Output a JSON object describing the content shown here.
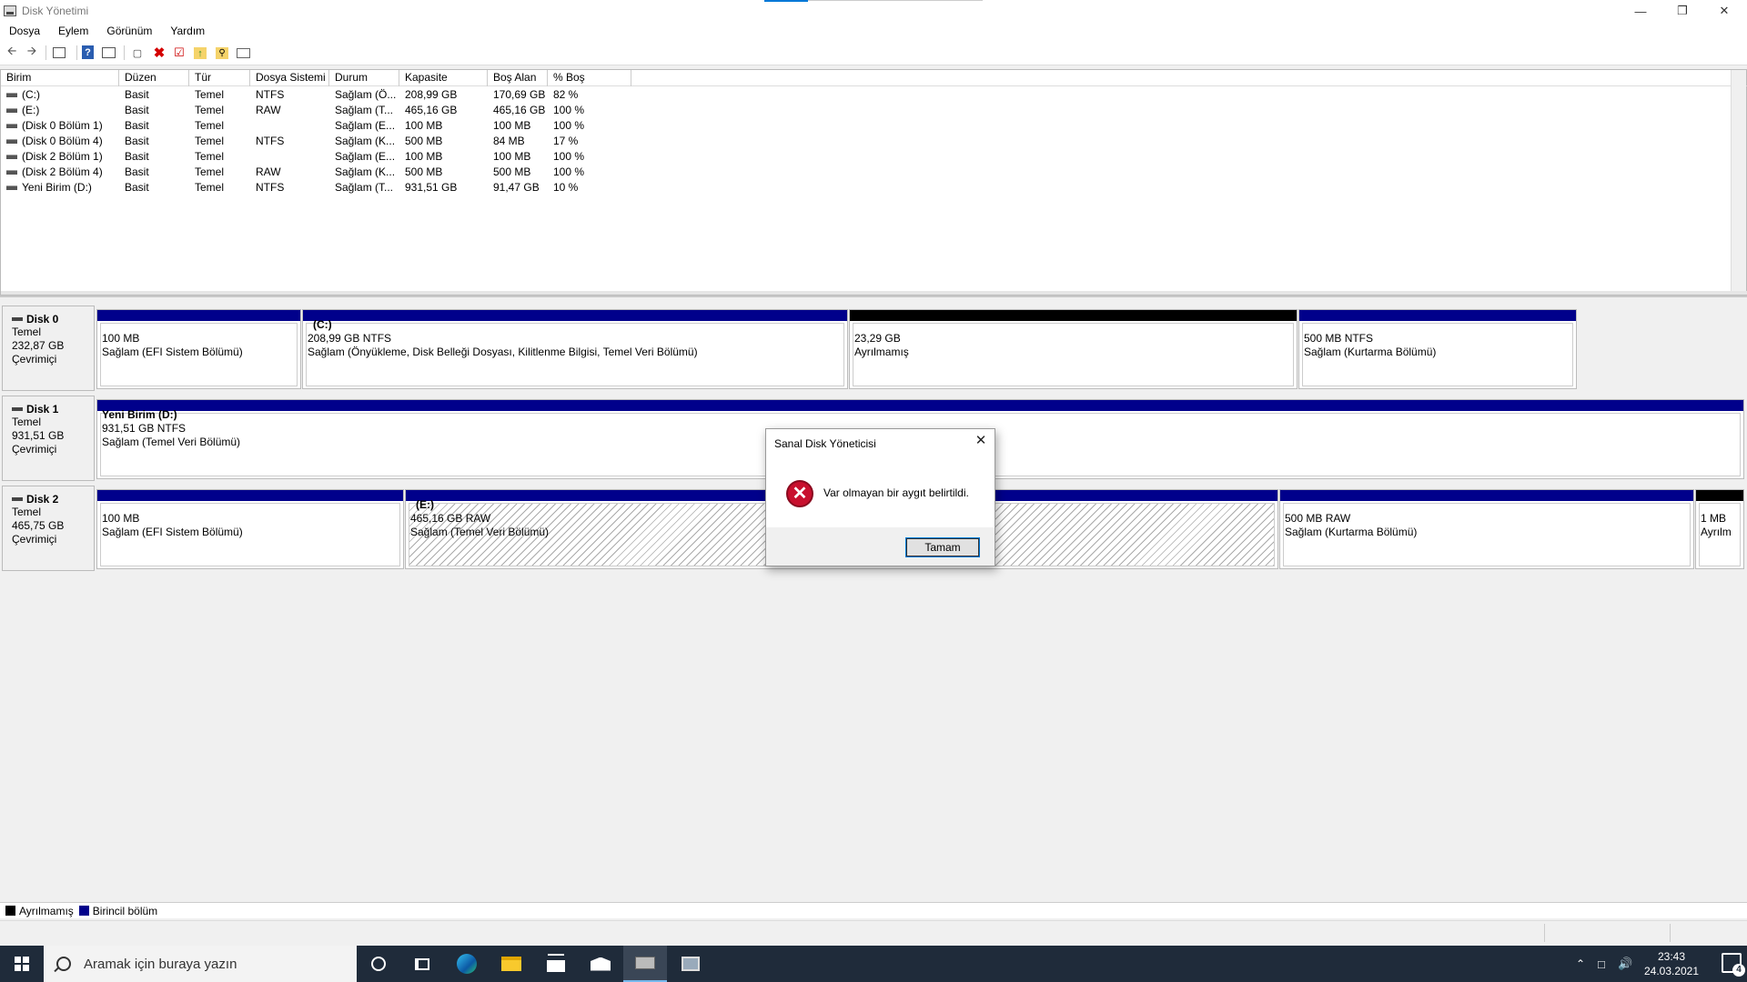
{
  "window": {
    "title": "Disk Yönetimi"
  },
  "menu": [
    "Dosya",
    "Eylem",
    "Görünüm",
    "Yardım"
  ],
  "toolbar": {
    "icons": [
      "back-icon",
      "forward-icon",
      "console-tree-icon",
      "help-icon",
      "properties-icon",
      "connect-icon",
      "delete-icon",
      "check-icon",
      "up-folder-icon",
      "search-folder-icon",
      "view-icon"
    ]
  },
  "volumes": {
    "headers": [
      "Birim",
      "Düzen",
      "Tür",
      "Dosya Sistemi",
      "Durum",
      "Kapasite",
      "Boş Alan",
      "% Boş"
    ],
    "rows": [
      [
        "(C:)",
        "Basit",
        "Temel",
        "NTFS",
        "Sağlam (Ö...",
        "208,99 GB",
        "170,69 GB",
        "82 %"
      ],
      [
        "(E:)",
        "Basit",
        "Temel",
        "RAW",
        "Sağlam (T...",
        "465,16 GB",
        "465,16 GB",
        "100 %"
      ],
      [
        "(Disk 0 Bölüm 1)",
        "Basit",
        "Temel",
        "",
        "Sağlam (E...",
        "100 MB",
        "100 MB",
        "100 %"
      ],
      [
        "(Disk 0 Bölüm 4)",
        "Basit",
        "Temel",
        "NTFS",
        "Sağlam (K...",
        "500 MB",
        "84 MB",
        "17 %"
      ],
      [
        "(Disk 2 Bölüm 1)",
        "Basit",
        "Temel",
        "",
        "Sağlam (E...",
        "100 MB",
        "100 MB",
        "100 %"
      ],
      [
        "(Disk 2 Bölüm 4)",
        "Basit",
        "Temel",
        "RAW",
        "Sağlam (K...",
        "500 MB",
        "500 MB",
        "100 %"
      ],
      [
        "Yeni Birim (D:)",
        "Basit",
        "Temel",
        "NTFS",
        "Sağlam (T...",
        "931,51 GB",
        "91,47 GB",
        "10 %"
      ]
    ]
  },
  "disks": [
    {
      "name": "Disk 0",
      "type": "Temel",
      "size": "232,87 GB",
      "status": "Çevrimiçi",
      "partitions": [
        {
          "title": "",
          "size": "100 MB",
          "status": "Sağlam (EFI Sistem Bölümü)",
          "kind": "primary"
        },
        {
          "title": "(C:)",
          "size": "208,99 GB NTFS",
          "status": "Sağlam (Önyükleme, Disk Belleği Dosyası, Kilitlenme Bilgisi, Temel Veri Bölümü)",
          "kind": "primary"
        },
        {
          "title": "",
          "size": "23,29 GB",
          "status": "Ayrılmamış",
          "kind": "unallocated"
        },
        {
          "title": "",
          "size": "500 MB NTFS",
          "status": "Sağlam (Kurtarma Bölümü)",
          "kind": "primary"
        }
      ]
    },
    {
      "name": "Disk 1",
      "type": "Temel",
      "size": "931,51 GB",
      "status": "Çevrimiçi",
      "partitions": [
        {
          "title": "Yeni Birim  (D:)",
          "size": "931,51 GB NTFS",
          "status": "Sağlam (Temel Veri Bölümü)",
          "kind": "primary"
        }
      ]
    },
    {
      "name": "Disk 2",
      "type": "Temel",
      "size": "465,75 GB",
      "status": "Çevrimiçi",
      "partitions": [
        {
          "title": "",
          "size": "100 MB",
          "status": "Sağlam (EFI Sistem Bölümü)",
          "kind": "primary"
        },
        {
          "title": "(E:)",
          "size": "465,16 GB RAW",
          "status": "Sağlam (Temel Veri Bölümü)",
          "kind": "primary-selected"
        },
        {
          "title": "",
          "size": "500 MB RAW",
          "status": "Sağlam (Kurtarma Bölümü)",
          "kind": "primary"
        },
        {
          "title": "",
          "size": "1 MB",
          "status": "Ayrılm",
          "kind": "unallocated"
        }
      ]
    }
  ],
  "legend": [
    {
      "label": "Ayrılmamış",
      "color": "#000000"
    },
    {
      "label": "Birincil bölüm",
      "color": "#00008b"
    }
  ],
  "dialog": {
    "title": "Sanal Disk Yöneticisi",
    "message": "Var olmayan bir aygıt belirtildi.",
    "ok": "Tamam",
    "icon": "error-icon"
  },
  "taskbar": {
    "search_placeholder": "Aramak için buraya yazın",
    "apps": [
      "cortana-icon",
      "task-view-icon",
      "edge-icon",
      "file-explorer-icon",
      "store-icon",
      "mail-icon",
      "disk-management-icon",
      "app-icon"
    ],
    "time": "23:43",
    "date": "24.03.2021",
    "notifications": "4"
  }
}
